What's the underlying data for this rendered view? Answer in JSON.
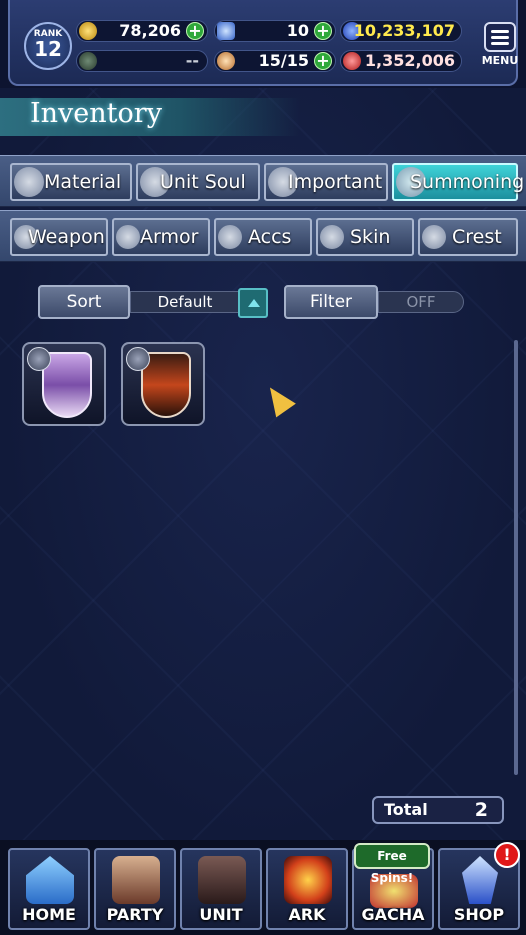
{
  "header": {
    "rank_label": "RANK",
    "rank_value": "12",
    "gold": "78,206",
    "crystals": "10",
    "gems": "10,233,107",
    "unknown_resource": "--",
    "stamina": "15/15",
    "red_currency": "1,352,006",
    "menu_label": "MENU"
  },
  "page": {
    "title": "Inventory"
  },
  "tabs_primary": [
    {
      "label": "Material",
      "icon": "bag-icon"
    },
    {
      "label": "Unit Soul",
      "icon": "soul-icon"
    },
    {
      "label": "Important",
      "icon": "star-icon"
    },
    {
      "label": "Summoning",
      "icon": "summon-icon",
      "active": true
    }
  ],
  "tabs_secondary": [
    {
      "label": "Weapon",
      "icon": "sword-icon"
    },
    {
      "label": "Armor",
      "icon": "armor-icon"
    },
    {
      "label": "Accs",
      "icon": "necklace-icon"
    },
    {
      "label": "Skin",
      "icon": "hanger-icon"
    },
    {
      "label": "Crest",
      "icon": "crest-icon"
    }
  ],
  "sort": {
    "label": "Sort",
    "value": "Default"
  },
  "filter": {
    "label": "Filter",
    "value": "OFF"
  },
  "items": [
    {
      "name": "summon-stone-purple",
      "color": "purple"
    },
    {
      "name": "summon-stone-fire",
      "color": "fire"
    }
  ],
  "total": {
    "label": "Total",
    "value": "2"
  },
  "nav": {
    "home": "HOME",
    "party": "PARTY",
    "unit": "UNIT",
    "ark": "ARK",
    "gacha": "GACHA",
    "shop": "SHOP",
    "free_spins": "Free Spins!",
    "alert": "!"
  },
  "colors": {
    "accent_active_tab": "#3fd3d8",
    "background": "#111a3a",
    "plus_green": "#2fa83a",
    "alert_red": "#e01818"
  }
}
